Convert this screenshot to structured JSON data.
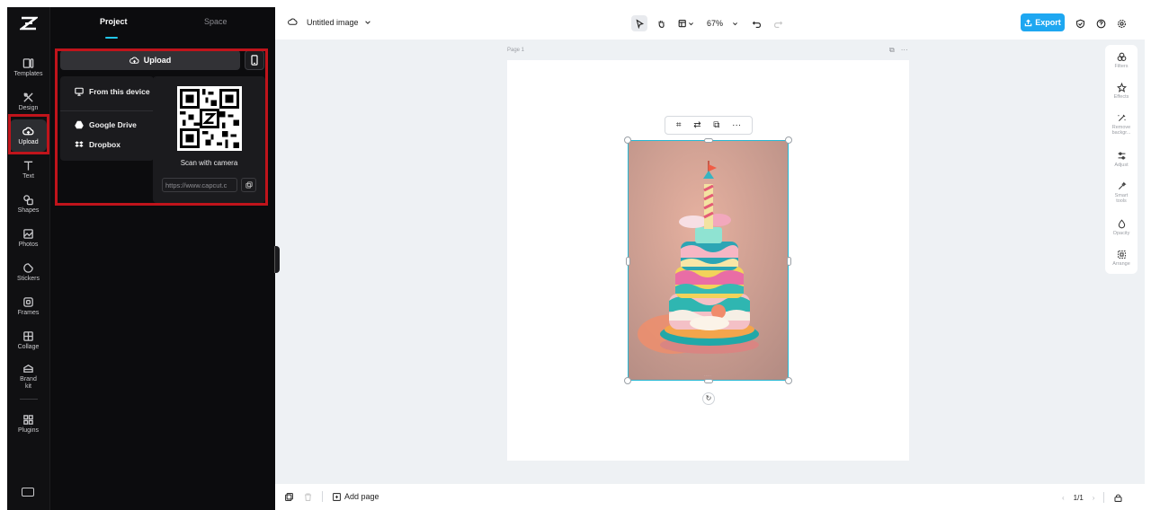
{
  "rail": {
    "items": [
      {
        "label": "Templates",
        "icon": "templates-icon"
      },
      {
        "label": "Design",
        "icon": "design-icon"
      },
      {
        "label": "Upload",
        "icon": "upload-icon"
      },
      {
        "label": "Text",
        "icon": "text-icon"
      },
      {
        "label": "Shapes",
        "icon": "shapes-icon"
      },
      {
        "label": "Photos",
        "icon": "photos-icon"
      },
      {
        "label": "Stickers",
        "icon": "stickers-icon"
      },
      {
        "label": "Frames",
        "icon": "frames-icon"
      },
      {
        "label": "Collage",
        "icon": "collage-icon"
      },
      {
        "label": "Brand kit",
        "icon": "brand-kit-icon"
      },
      {
        "label": "Plugins",
        "icon": "plugins-icon"
      }
    ],
    "active": "Upload"
  },
  "panel": {
    "tabs": [
      "Project",
      "Space"
    ],
    "upload_label": "Upload",
    "sources": {
      "from_device": "From this device",
      "google_drive": "Google Drive",
      "dropbox": "Dropbox"
    },
    "qr": {
      "caption": "Scan with camera",
      "link": "https://www.capcut.c"
    }
  },
  "topbar": {
    "title": "Untitled image",
    "zoom": "67%",
    "export_label": "Export"
  },
  "canvas": {
    "page_label": "Page 1",
    "page_more": "···",
    "float_more": "···"
  },
  "right_tools": [
    {
      "label": "Filters",
      "icon": "filters-icon"
    },
    {
      "label": "Effects",
      "icon": "effects-icon"
    },
    {
      "label": "Remove backgr...",
      "icon": "remove-background-icon"
    },
    {
      "label": "Adjust",
      "icon": "adjust-icon"
    },
    {
      "label": "Smart tools",
      "icon": "smart-tools-icon"
    },
    {
      "label": "Opacity",
      "icon": "opacity-icon"
    },
    {
      "label": "Arrange",
      "icon": "arrange-icon"
    }
  ],
  "bottombar": {
    "add_page": "Add page",
    "page_count": "1/1"
  },
  "colors": {
    "accent": "#22c6e8",
    "export": "#1ea7f1",
    "highlight": "#c0141b"
  }
}
